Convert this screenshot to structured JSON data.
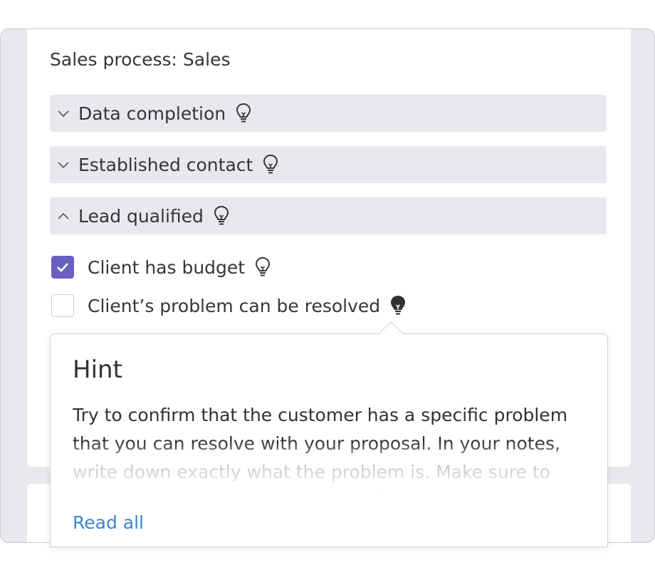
{
  "process": {
    "title": "Sales process: Sales"
  },
  "sections": [
    {
      "label": "Data completion",
      "expanded": false,
      "icon": "chevron-down-icon",
      "hint_icon": "lightbulb-outline-icon"
    },
    {
      "label": "Established contact",
      "expanded": false,
      "icon": "chevron-down-icon",
      "hint_icon": "lightbulb-outline-icon"
    },
    {
      "label": "Lead qualified",
      "expanded": true,
      "icon": "chevron-up-icon",
      "hint_icon": "lightbulb-outline-icon"
    }
  ],
  "checklist": [
    {
      "label": "Client has budget",
      "checked": true,
      "hint_icon": "lightbulb-outline-icon"
    },
    {
      "label": "Client’s problem can be resolved",
      "checked": false,
      "hint_icon": "lightbulb-filled-icon"
    }
  ],
  "hint": {
    "title": "Hint",
    "text": "Try to confirm that the customer has a specific problem that you can resolve with your proposal. In your notes, write down exactly what the problem is. Make sure to use the same language that the client uses.",
    "read_all_label": "Read all"
  },
  "colors": {
    "accent": "#6a5fc1",
    "link": "#3c86c9",
    "section_bg": "#e8e9ed",
    "frame_bg": "#e8e9ed"
  }
}
